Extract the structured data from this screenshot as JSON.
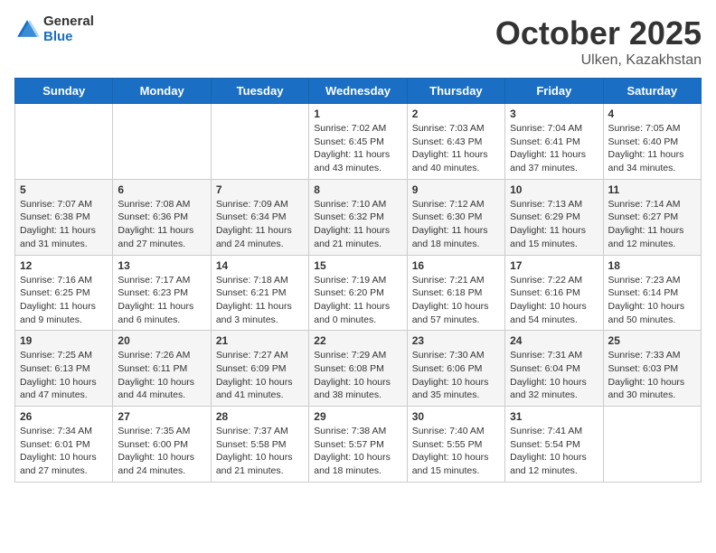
{
  "header": {
    "logo_general": "General",
    "logo_blue": "Blue",
    "month": "October 2025",
    "location": "Ulken, Kazakhstan"
  },
  "weekdays": [
    "Sunday",
    "Monday",
    "Tuesday",
    "Wednesday",
    "Thursday",
    "Friday",
    "Saturday"
  ],
  "weeks": [
    [
      {
        "day": "",
        "info": ""
      },
      {
        "day": "",
        "info": ""
      },
      {
        "day": "",
        "info": ""
      },
      {
        "day": "1",
        "info": "Sunrise: 7:02 AM\nSunset: 6:45 PM\nDaylight: 11 hours\nand 43 minutes."
      },
      {
        "day": "2",
        "info": "Sunrise: 7:03 AM\nSunset: 6:43 PM\nDaylight: 11 hours\nand 40 minutes."
      },
      {
        "day": "3",
        "info": "Sunrise: 7:04 AM\nSunset: 6:41 PM\nDaylight: 11 hours\nand 37 minutes."
      },
      {
        "day": "4",
        "info": "Sunrise: 7:05 AM\nSunset: 6:40 PM\nDaylight: 11 hours\nand 34 minutes."
      }
    ],
    [
      {
        "day": "5",
        "info": "Sunrise: 7:07 AM\nSunset: 6:38 PM\nDaylight: 11 hours\nand 31 minutes."
      },
      {
        "day": "6",
        "info": "Sunrise: 7:08 AM\nSunset: 6:36 PM\nDaylight: 11 hours\nand 27 minutes."
      },
      {
        "day": "7",
        "info": "Sunrise: 7:09 AM\nSunset: 6:34 PM\nDaylight: 11 hours\nand 24 minutes."
      },
      {
        "day": "8",
        "info": "Sunrise: 7:10 AM\nSunset: 6:32 PM\nDaylight: 11 hours\nand 21 minutes."
      },
      {
        "day": "9",
        "info": "Sunrise: 7:12 AM\nSunset: 6:30 PM\nDaylight: 11 hours\nand 18 minutes."
      },
      {
        "day": "10",
        "info": "Sunrise: 7:13 AM\nSunset: 6:29 PM\nDaylight: 11 hours\nand 15 minutes."
      },
      {
        "day": "11",
        "info": "Sunrise: 7:14 AM\nSunset: 6:27 PM\nDaylight: 11 hours\nand 12 minutes."
      }
    ],
    [
      {
        "day": "12",
        "info": "Sunrise: 7:16 AM\nSunset: 6:25 PM\nDaylight: 11 hours\nand 9 minutes."
      },
      {
        "day": "13",
        "info": "Sunrise: 7:17 AM\nSunset: 6:23 PM\nDaylight: 11 hours\nand 6 minutes."
      },
      {
        "day": "14",
        "info": "Sunrise: 7:18 AM\nSunset: 6:21 PM\nDaylight: 11 hours\nand 3 minutes."
      },
      {
        "day": "15",
        "info": "Sunrise: 7:19 AM\nSunset: 6:20 PM\nDaylight: 11 hours\nand 0 minutes."
      },
      {
        "day": "16",
        "info": "Sunrise: 7:21 AM\nSunset: 6:18 PM\nDaylight: 10 hours\nand 57 minutes."
      },
      {
        "day": "17",
        "info": "Sunrise: 7:22 AM\nSunset: 6:16 PM\nDaylight: 10 hours\nand 54 minutes."
      },
      {
        "day": "18",
        "info": "Sunrise: 7:23 AM\nSunset: 6:14 PM\nDaylight: 10 hours\nand 50 minutes."
      }
    ],
    [
      {
        "day": "19",
        "info": "Sunrise: 7:25 AM\nSunset: 6:13 PM\nDaylight: 10 hours\nand 47 minutes."
      },
      {
        "day": "20",
        "info": "Sunrise: 7:26 AM\nSunset: 6:11 PM\nDaylight: 10 hours\nand 44 minutes."
      },
      {
        "day": "21",
        "info": "Sunrise: 7:27 AM\nSunset: 6:09 PM\nDaylight: 10 hours\nand 41 minutes."
      },
      {
        "day": "22",
        "info": "Sunrise: 7:29 AM\nSunset: 6:08 PM\nDaylight: 10 hours\nand 38 minutes."
      },
      {
        "day": "23",
        "info": "Sunrise: 7:30 AM\nSunset: 6:06 PM\nDaylight: 10 hours\nand 35 minutes."
      },
      {
        "day": "24",
        "info": "Sunrise: 7:31 AM\nSunset: 6:04 PM\nDaylight: 10 hours\nand 32 minutes."
      },
      {
        "day": "25",
        "info": "Sunrise: 7:33 AM\nSunset: 6:03 PM\nDaylight: 10 hours\nand 30 minutes."
      }
    ],
    [
      {
        "day": "26",
        "info": "Sunrise: 7:34 AM\nSunset: 6:01 PM\nDaylight: 10 hours\nand 27 minutes."
      },
      {
        "day": "27",
        "info": "Sunrise: 7:35 AM\nSunset: 6:00 PM\nDaylight: 10 hours\nand 24 minutes."
      },
      {
        "day": "28",
        "info": "Sunrise: 7:37 AM\nSunset: 5:58 PM\nDaylight: 10 hours\nand 21 minutes."
      },
      {
        "day": "29",
        "info": "Sunrise: 7:38 AM\nSunset: 5:57 PM\nDaylight: 10 hours\nand 18 minutes."
      },
      {
        "day": "30",
        "info": "Sunrise: 7:40 AM\nSunset: 5:55 PM\nDaylight: 10 hours\nand 15 minutes."
      },
      {
        "day": "31",
        "info": "Sunrise: 7:41 AM\nSunset: 5:54 PM\nDaylight: 10 hours\nand 12 minutes."
      },
      {
        "day": "",
        "info": ""
      }
    ]
  ]
}
